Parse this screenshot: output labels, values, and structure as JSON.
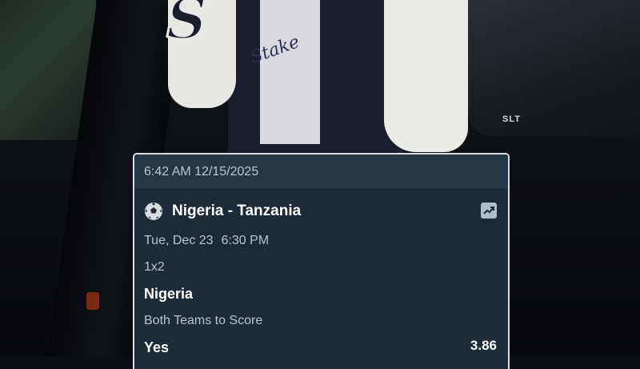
{
  "background": {
    "jacket_letter": "S",
    "jacket_script": "Stake",
    "car_badge": "SLT"
  },
  "bet_slip": {
    "timestamp": "6:42 AM 12/15/2025",
    "sport_icon": "soccer-ball-icon",
    "match": "Nigeria - Tanzania",
    "trend_icon": "trending-up-icon",
    "event_date": "Tue, Dec 23",
    "event_time": "6:30 PM",
    "legs": [
      {
        "market": "1x2",
        "selection": "Nigeria"
      },
      {
        "market": "Both Teams to Score",
        "selection": "Yes",
        "odds": "3.86"
      }
    ]
  },
  "colors": {
    "card_bg": "#1c2b37",
    "card_header_bg": "#253745",
    "muted_text": "#b8c6d0",
    "primary_text": "#ffffff"
  }
}
